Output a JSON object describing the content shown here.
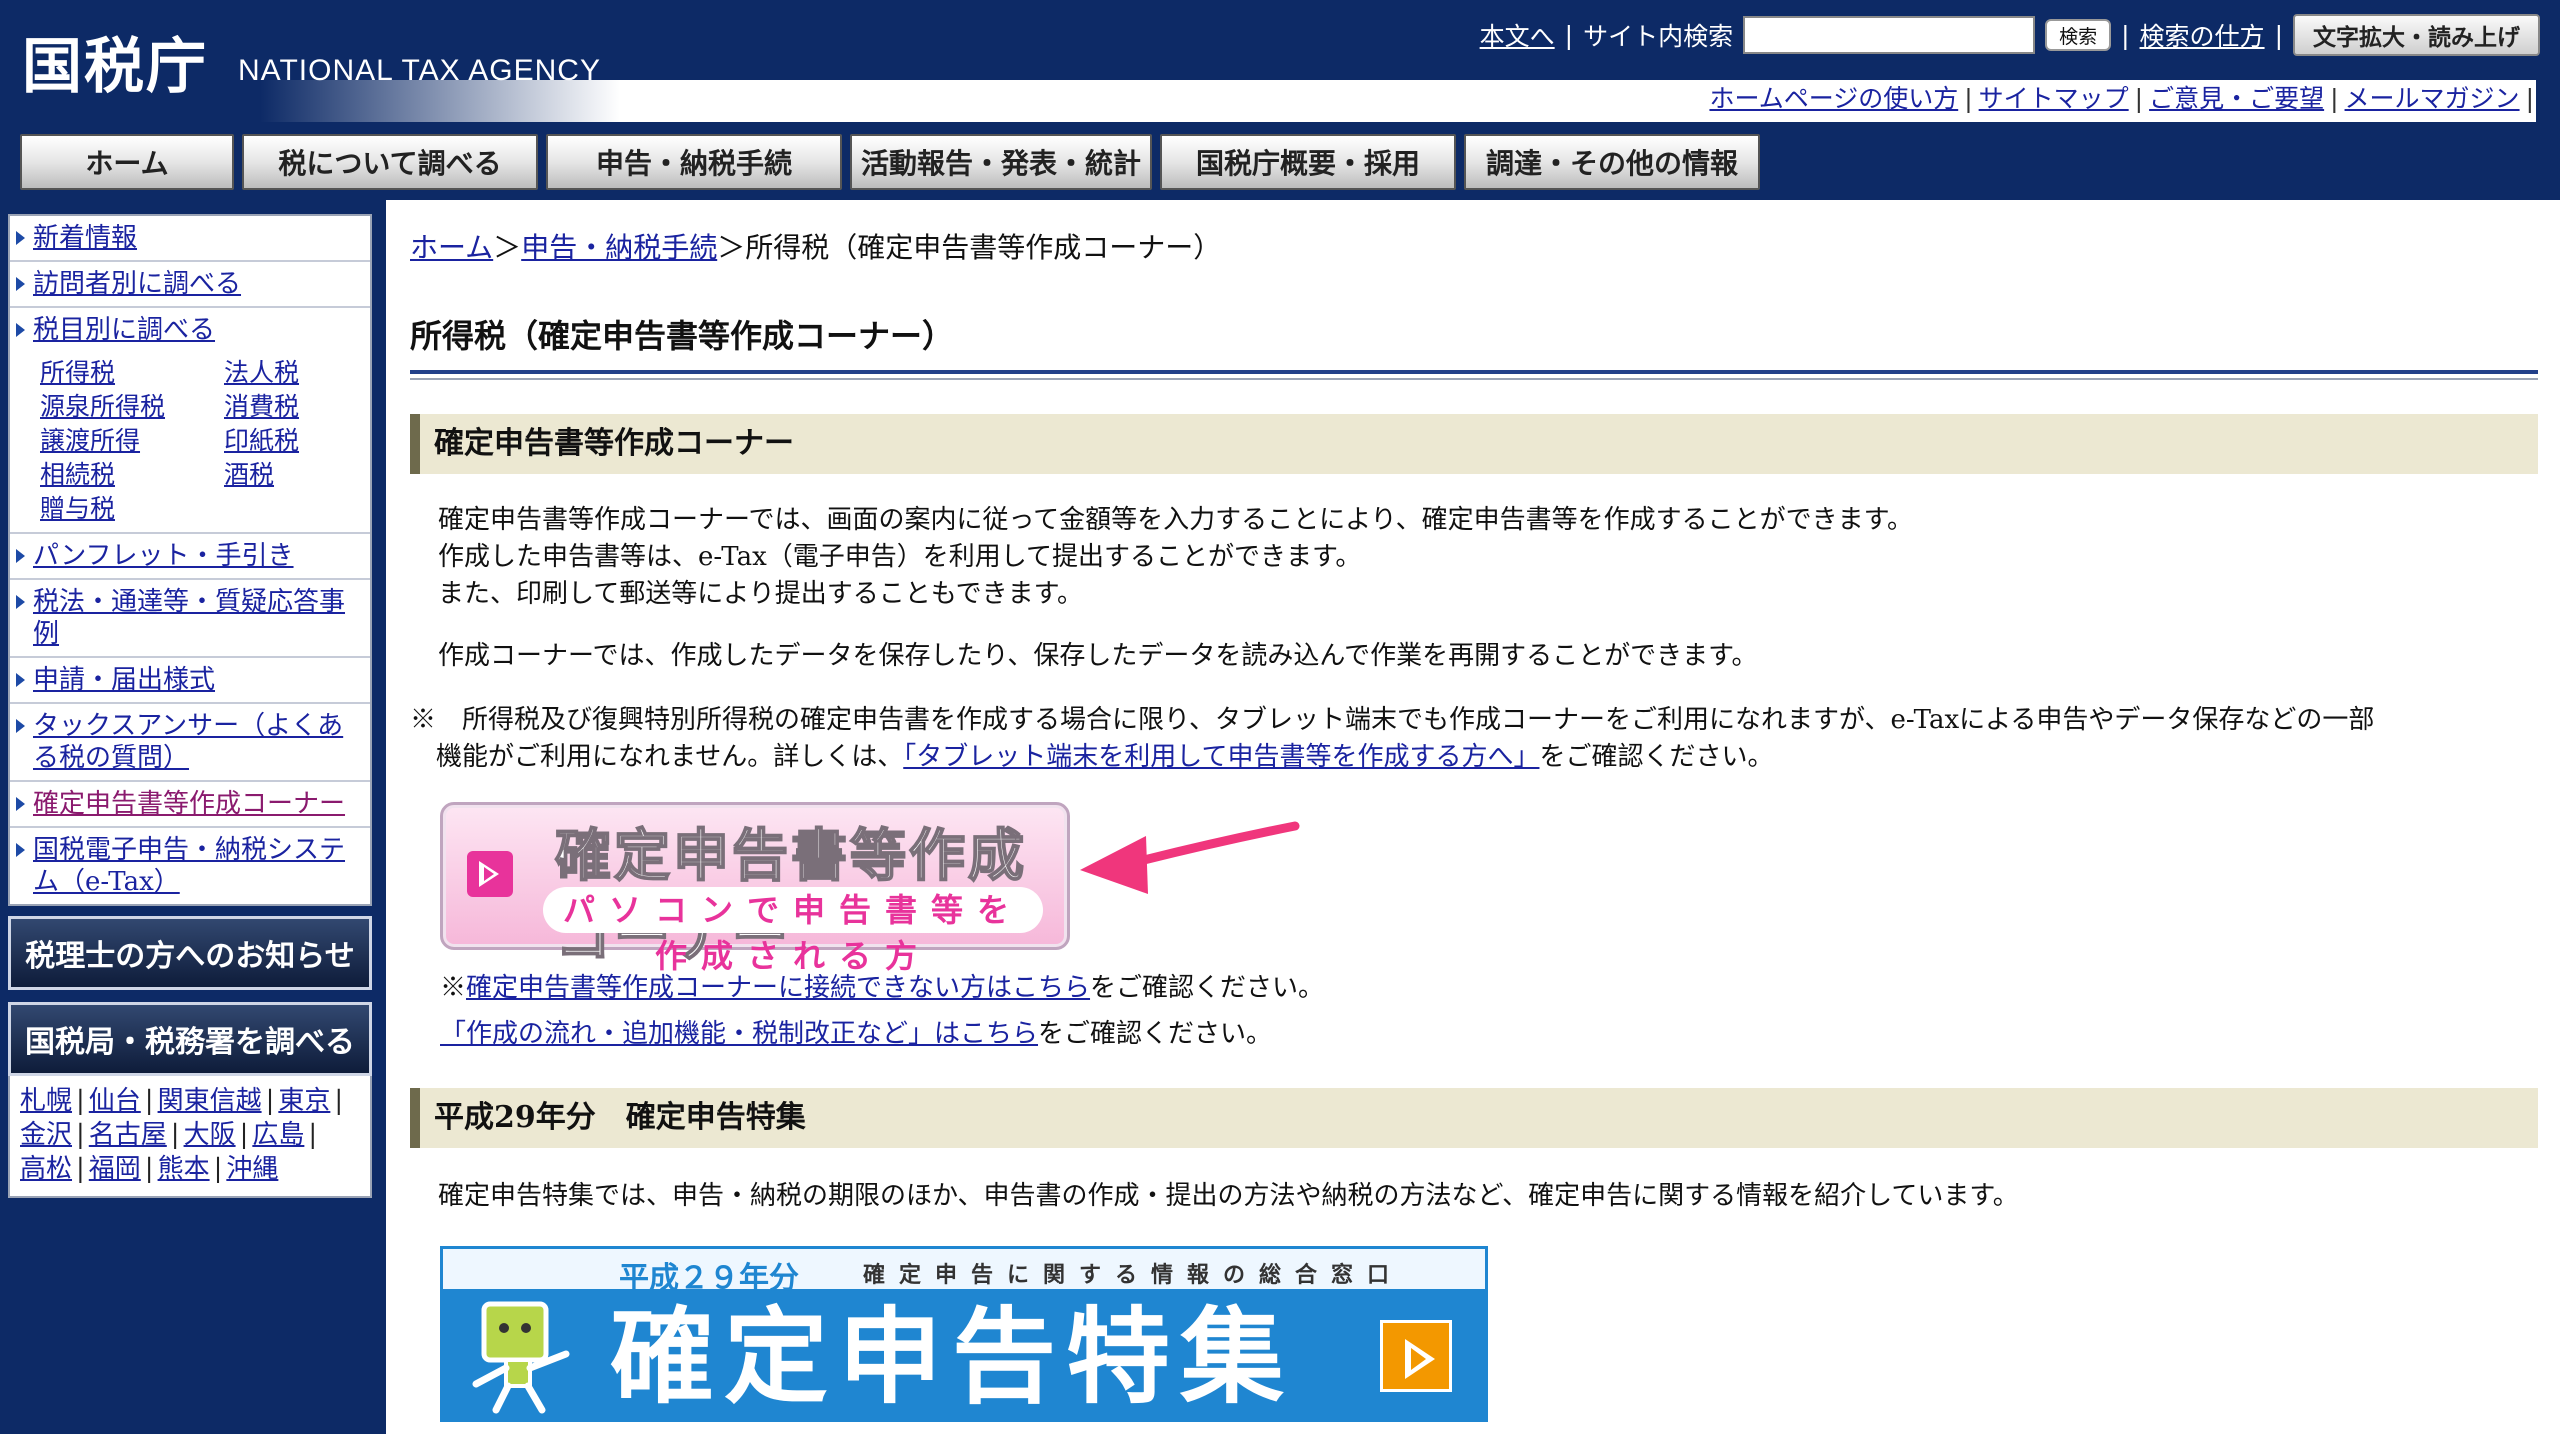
{
  "header": {
    "logo_ja": "国税庁",
    "logo_en": "NATIONAL TAX AGENCY",
    "skip_link": "本文へ",
    "site_search_label": "サイト内検索",
    "search_value": "",
    "search_button": "検索",
    "search_help": "検索の仕方",
    "font_size_button": "文字拡大・読み上げ",
    "sub_links": [
      "ホームページの使い方",
      "サイトマップ",
      "ご意見・ご要望",
      "メールマガジン"
    ]
  },
  "nav": {
    "items": [
      "ホーム",
      "税について調べる",
      "申告・納税手続",
      "活動報告・発表・統計",
      "国税庁概要・採用",
      "調達・その他の情報"
    ]
  },
  "sidebar": {
    "items_top": [
      "新着情報",
      "訪問者別に調べる",
      "税目別に調べる"
    ],
    "tax_items": [
      "所得税",
      "法人税",
      "源泉所得税",
      "消費税",
      "譲渡所得",
      "印紙税",
      "相続税",
      "酒税",
      "贈与税"
    ],
    "items_bottom": [
      "パンフレット・手引き",
      "税法・通達等・質疑応答事例",
      "申請・届出様式",
      "タックスアンサー（よくある税の質問）",
      "確定申告書等作成コーナー",
      "国税電子申告・納税システム（e-Tax）"
    ],
    "tax_accountant_button": "税理士の方へのお知らせ",
    "bureau_button": "国税局・税務署を調べる",
    "bureaus": [
      "札幌",
      "仙台",
      "関東信越",
      "東京",
      "金沢",
      "名古屋",
      "大阪",
      "広島",
      "高松",
      "福岡",
      "熊本",
      "沖縄"
    ]
  },
  "main": {
    "breadcrumb": {
      "home": "ホーム",
      "sep1": "＞",
      "procedures": "申告・納税手続",
      "sep2": "＞",
      "current": "所得税（確定申告書等作成コーナー）"
    },
    "page_title": "所得税（確定申告書等作成コーナー）",
    "section1": {
      "heading": "確定申告書等作成コーナー",
      "p1": "確定申告書等作成コーナーでは、画面の案内に従って金額等を入力することにより、確定申告書等を作成することができます。",
      "p2": "作成した申告書等は、e-Tax（電子申告）を利用して提出することができます。",
      "p3": "また、印刷して郵送等により提出することもできます。",
      "p4": "作成コーナーでは、作成したデータを保存したり、保存したデータを読み込んで作業を再開することができます。",
      "note_prefix": "※　所得税及び復興特別所得税の確定申告書を作成する場合に限り、タブレット端末でも作成コーナーをご利用になれますが、e-Taxによる申告やデータ保存などの一部",
      "note_line2_pre": "機能がご利用になれません。詳しくは、",
      "note_link": "「タブレット端末を利用して申告書等を作成する方へ」",
      "note_line2_post": "をご確認ください。",
      "banner_title": "確定申告書等作成コーナー",
      "banner_sub": "パソコンで申告書等を作成される方",
      "connect_prefix": "※",
      "connect_link": "確定申告書等作成コーナーに接続できない方はこちら",
      "connect_suffix": "をご確認ください。",
      "flow_link": "「作成の流れ・追加機能・税制改正など」はこちら",
      "flow_suffix": "をご確認ください。"
    },
    "section2": {
      "heading": "平成29年分　確定申告特集",
      "p1": "確定申告特集では、申告・納税の期限のほか、申告書の作成・提出の方法や納税の方法など、確定申告に関する情報を紹介しています。",
      "banner_year": "平成２９年分",
      "banner_sub": "確定申告に関する情報の総合窓口",
      "banner_title": "確定申告特集"
    }
  },
  "colors": {
    "header_bg": "#0d2a66",
    "link": "#1a23a0",
    "section_head_bg": "#ece8d2",
    "pink_accent": "#e8339b",
    "blue_banner": "#1f86d1",
    "orange_go": "#f39800"
  }
}
